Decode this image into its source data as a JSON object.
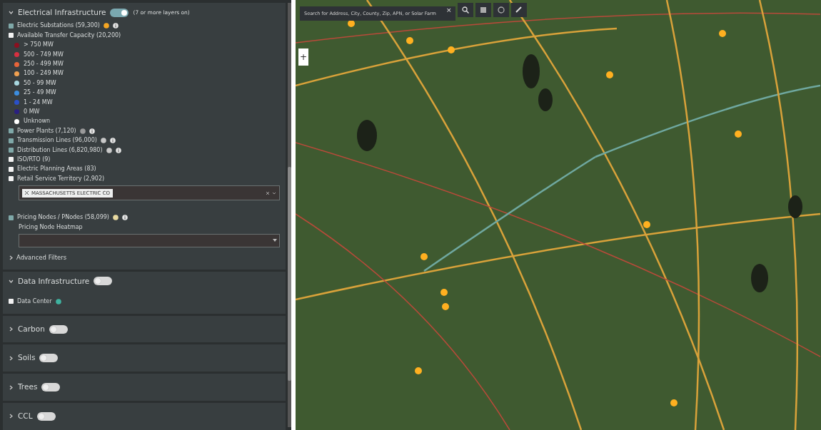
{
  "sidebar": {
    "sections": [
      {
        "title": "Electrical Infrastructure",
        "expanded": true,
        "on": true,
        "note": "(7 or more layers on)",
        "items": [
          {
            "kind": "checkbox",
            "label": "Electric Substations (59,300)",
            "checked": true,
            "color": "#f5a623",
            "info": true
          },
          {
            "kind": "checkbox",
            "label": "Available Transfer Capacity (20,200)",
            "checked": false,
            "info": false
          },
          {
            "kind": "legend",
            "entries": [
              {
                "label": "> 750 MW",
                "color": "#8b1020"
              },
              {
                "label": "500 - 749 MW",
                "color": "#d63040"
              },
              {
                "label": "250 - 499 MW",
                "color": "#e8643a"
              },
              {
                "label": "100 - 249 MW",
                "color": "#f0a050"
              },
              {
                "label": "50 - 99 MW",
                "color": "#a8d8e0"
              },
              {
                "label": "25 - 49 MW",
                "color": "#3c8ee0"
              },
              {
                "label": "1 - 24 MW",
                "color": "#2a50c8"
              },
              {
                "label": "0 MW",
                "color": "#2a2080"
              },
              {
                "label": "Unknown",
                "color": "#ffffff"
              }
            ]
          },
          {
            "kind": "checkbox",
            "label": "Power Plants (7,120)",
            "checked": true,
            "color": "#9a9a9a",
            "info": true
          },
          {
            "kind": "checkbox",
            "label": "Transmission Lines (96,000)",
            "checked": true,
            "color": "#c8c8c8",
            "info": true
          },
          {
            "kind": "checkbox",
            "label": "Distribution Lines (6,820,980)",
            "checked": true,
            "color": "#c9c9c9",
            "info": true
          },
          {
            "kind": "checkbox",
            "label": "ISO/RTO (9)",
            "checked": false,
            "info": false
          },
          {
            "kind": "checkbox",
            "label": "Electric Planning Areas (83)",
            "checked": false,
            "info": false
          },
          {
            "kind": "checkbox",
            "label": "Retail Service Territory (2,902)",
            "checked": false,
            "info": false
          },
          {
            "kind": "tags",
            "tags": [
              "MASSACHUSETTS ELECTRIC CO"
            ]
          },
          {
            "kind": "checkbox",
            "label": "Pricing Nodes / PNodes (58,099)",
            "checked": true,
            "color": "#e8d9a0",
            "info": true
          },
          {
            "kind": "select",
            "label": "Pricing Node Heatmap"
          },
          {
            "kind": "filters",
            "label": "Advanced Filters",
            "expanded": false
          }
        ]
      },
      {
        "title": "Data Infrastructure",
        "expanded": true,
        "on": false,
        "items": [
          {
            "kind": "checkbox",
            "label": "Data Center",
            "checked": false,
            "color": "#3fb3a0",
            "info": false
          }
        ]
      },
      {
        "title": "Carbon",
        "expanded": false,
        "on": false
      },
      {
        "title": "Soils",
        "expanded": false,
        "on": false
      },
      {
        "title": "Trees",
        "expanded": false,
        "on": false
      },
      {
        "title": "CCL",
        "expanded": false,
        "on": false
      }
    ]
  },
  "map": {
    "search": {
      "placeholder": "Search for Address, City, County, Zip, APN, or Solar Farm"
    },
    "clear": "×",
    "zoom_in": "+"
  }
}
